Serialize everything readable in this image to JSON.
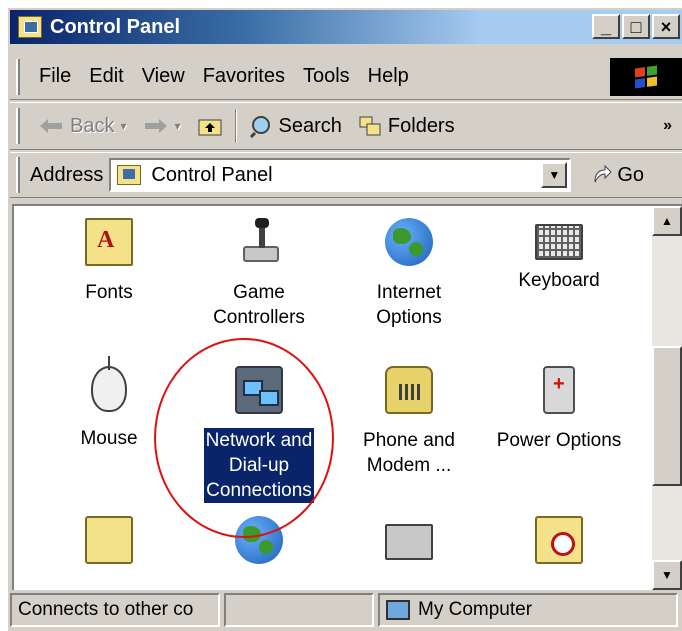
{
  "window": {
    "title": "Control Panel"
  },
  "title_buttons": [
    "_",
    "□",
    "×"
  ],
  "menubar": {
    "items": [
      "File",
      "Edit",
      "View",
      "Favorites",
      "Tools",
      "Help"
    ]
  },
  "toolbar": {
    "back_label": "Back",
    "search_label": "Search",
    "folders_label": "Folders",
    "overflow": "»"
  },
  "address": {
    "label": "Address",
    "value": "Control Panel",
    "go_label": "Go"
  },
  "content": {
    "items": [
      {
        "label": "Fonts",
        "icon": "fonts-icon"
      },
      {
        "label": "Game\nControllers",
        "icon": "game-controller-icon"
      },
      {
        "label": "Internet\nOptions",
        "icon": "internet-options-icon"
      },
      {
        "label": "Keyboard",
        "icon": "keyboard-icon"
      },
      {
        "label": "Mouse",
        "icon": "mouse-icon"
      },
      {
        "label": "Network and\nDial-up\nConnections",
        "icon": "network-icon",
        "selected": true
      },
      {
        "label": "Phone and\nModem ...",
        "icon": "phone-icon"
      },
      {
        "label": "Power Options",
        "icon": "power-icon"
      }
    ],
    "lines": {
      "fonts": "Fonts",
      "game1": "Game",
      "game2": "Controllers",
      "inet1": "Internet",
      "inet2": "Options",
      "keyboard": "Keyboard",
      "mouse": "Mouse",
      "net1": "Network and",
      "net2": "Dial-up",
      "net3": "Connections",
      "phone1": "Phone and",
      "phone2": "Modem ...",
      "power": "Power Options"
    }
  },
  "statusbar": {
    "description": "Connects to other co",
    "zone": "My Computer"
  },
  "colors": {
    "selection": "#0a246a",
    "highlight_circle": "#e01010",
    "window_face": "#d4d0c8"
  }
}
